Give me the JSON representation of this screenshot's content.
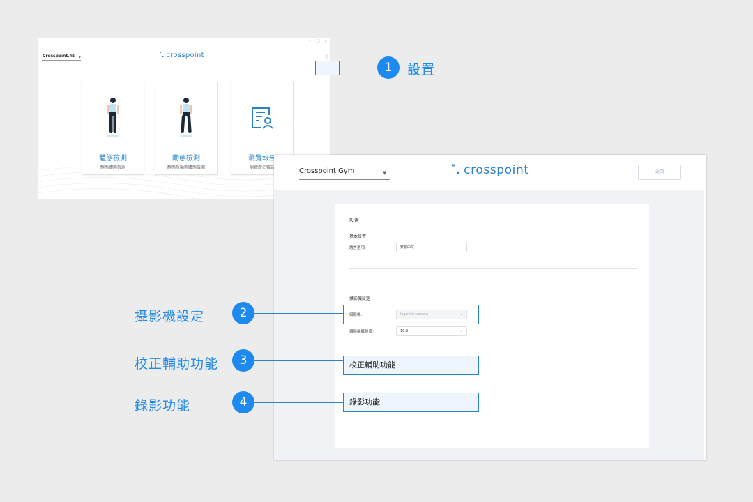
{
  "home": {
    "gym": "Crosspoint.fit",
    "logo": "crosspoint",
    "logo_mark": "˟.",
    "menu": "⋮",
    "cards": [
      {
        "title": "體態檢測",
        "subtitle": "靜態體態檢測"
      },
      {
        "title": "動態檢測",
        "subtitle": "靜態及動態體態檢測"
      },
      {
        "title": "瀏覽報告",
        "subtitle": "瀏覽歷史報告"
      }
    ]
  },
  "settings": {
    "gym": "Crosspoint Gym",
    "logo": "crosspoint",
    "logo_mark": "˟.",
    "return_label": "返回",
    "panel_title": "設置",
    "basic_section": "基本設置",
    "language_label": "語言選項:",
    "language_value": "繁體中文",
    "camera_section": "攝影機設定",
    "camera_label": "攝影機:",
    "camera_value": "logic hd camera",
    "resolution_label": "攝影機解析度:",
    "resolution_value": "16:9",
    "calibration_label": "校正輔助功能",
    "recording_label": "錄影功能"
  },
  "callouts": [
    {
      "number": "1",
      "label": "設置"
    },
    {
      "number": "2",
      "label": "攝影機設定"
    },
    {
      "number": "3",
      "label": "校正輔助功能"
    },
    {
      "number": "4",
      "label": "錄影功能"
    }
  ],
  "colors": {
    "accent": "#1e8af0",
    "brand": "#2a83c9",
    "background": "#ececed"
  }
}
